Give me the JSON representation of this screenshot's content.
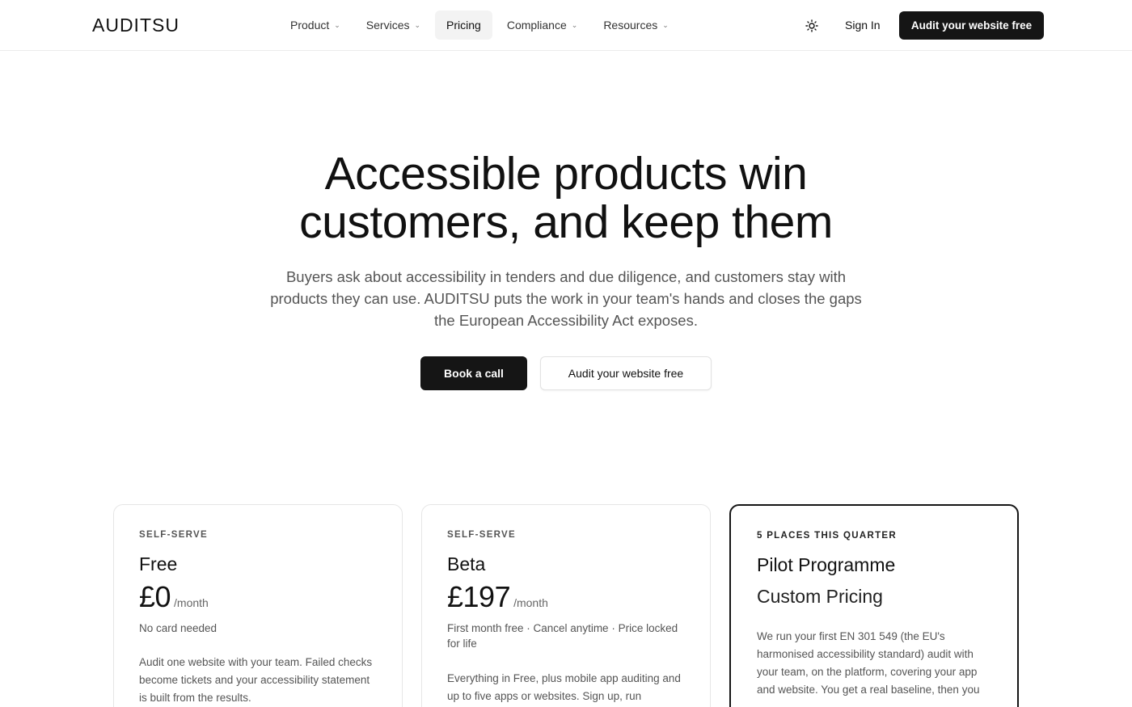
{
  "header": {
    "logo": "AUDITSU",
    "nav": [
      {
        "label": "Product",
        "has_dropdown": true,
        "active": false
      },
      {
        "label": "Services",
        "has_dropdown": true,
        "active": false
      },
      {
        "label": "Pricing",
        "has_dropdown": false,
        "active": true
      },
      {
        "label": "Compliance",
        "has_dropdown": true,
        "active": false
      },
      {
        "label": "Resources",
        "has_dropdown": true,
        "active": false
      }
    ],
    "theme_icon": "sun-icon",
    "sign_in": "Sign In",
    "cta": "Audit your website free"
  },
  "hero": {
    "title_line1": "Accessible products win",
    "title_line2": "customers, and keep them",
    "subtitle": "Buyers ask about accessibility in tenders and due diligence, and customers stay with products they can use. AUDITSU puts the work in your team's hands and closes the gaps the European Accessibility Act exposes.",
    "primary_button": "Book a call",
    "secondary_button": "Audit your website free"
  },
  "plans": [
    {
      "eyebrow": "SELF-SERVE",
      "name": "Free",
      "price": "£0",
      "period": "/month",
      "note": "No card needed",
      "description": "Audit one website with your team. Failed checks become tickets and your accessibility statement is built from the results."
    },
    {
      "eyebrow": "SELF-SERVE",
      "name": "Beta",
      "price": "£197",
      "period": "/month",
      "note": "First month free · Cancel anytime · Price locked for life",
      "description": "Everything in Free, plus mobile app auditing and up to five apps or websites. Sign up, run"
    },
    {
      "eyebrow": "5 PLACES THIS QUARTER",
      "name": "Pilot Programme",
      "price_label": "Custom Pricing",
      "description": "We run your first EN 301 549 (the EU's harmonised accessibility standard) audit with your team, on the platform, covering your app and website. You get a real baseline, then you"
    }
  ],
  "colors": {
    "primary_dark": "#151515",
    "text": "#111111",
    "muted": "#555555",
    "border": "#e6e6e6"
  }
}
